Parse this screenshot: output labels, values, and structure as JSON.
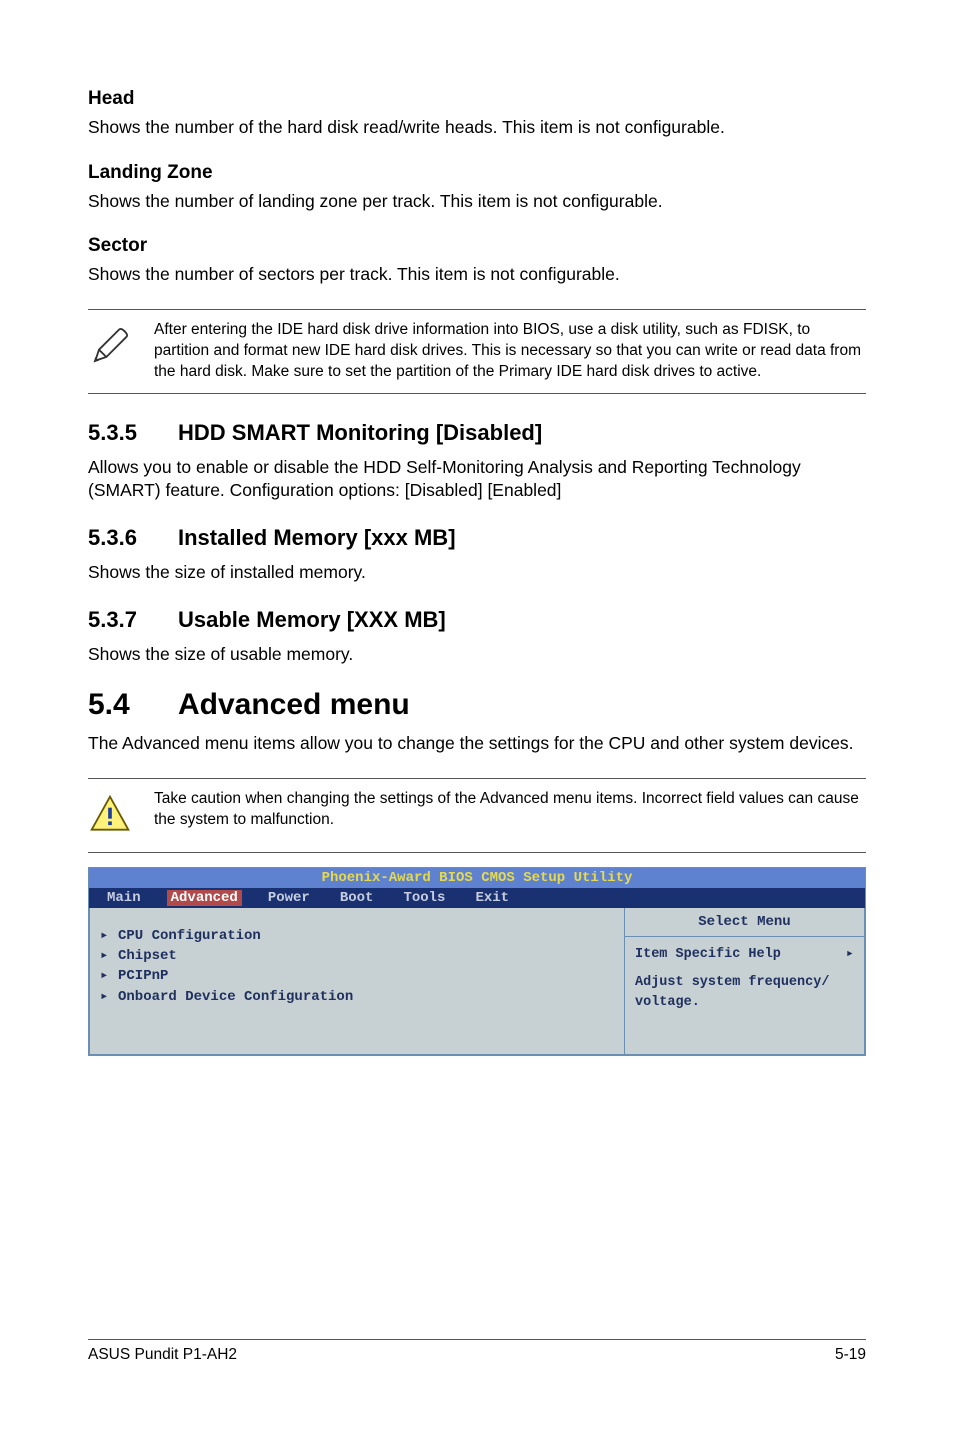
{
  "sec_head": {
    "title": "Head",
    "body": "Shows the number of the hard disk read/write heads. This item is not configurable."
  },
  "sec_lz": {
    "title": "Landing Zone",
    "body": "Shows the number of landing zone per track. This item is not configurable."
  },
  "sec_sect": {
    "title": "Sector",
    "body": "Shows the number of sectors per track. This item is not configurable."
  },
  "note1": "After entering the IDE hard disk drive information into BIOS, use a disk utility, such as FDISK, to partition and format new IDE hard disk drives. This is necessary so that you can write or read data from the hard disk. Make sure to set the partition of the Primary IDE hard disk drives to active.",
  "s535": {
    "no": "5.3.5",
    "title": "HDD SMART Monitoring [Disabled]",
    "body": "Allows you to enable or disable the HDD Self-Monitoring Analysis and Reporting Technology (SMART) feature. Configuration options: [Disabled] [Enabled]"
  },
  "s536": {
    "no": "5.3.6",
    "title": "Installed Memory [xxx MB]",
    "body": "Shows the size of installed memory."
  },
  "s537": {
    "no": "5.3.7",
    "title": "Usable Memory [XXX MB]",
    "body": "Shows the size of usable memory."
  },
  "s54": {
    "no": "5.4",
    "title": "Advanced menu",
    "body": "The Advanced menu items allow you to change the settings for the CPU and other system devices."
  },
  "note2": "Take caution when changing the settings of the Advanced menu items. Incorrect field values can cause the system to malfunction.",
  "bios": {
    "title": "Phoenix-Award BIOS CMOS Setup Utility",
    "tabs": [
      "Main",
      "Advanced",
      "Power",
      "Boot",
      "Tools",
      "Exit"
    ],
    "selected_tab": 1,
    "left": [
      "CPU Configuration",
      "Chipset",
      "PCIPnP",
      "Onboard Device Configuration"
    ],
    "right_title": "Select Menu",
    "right_line1": "Item Specific Help",
    "right_body": "Adjust system frequency/ voltage."
  },
  "footer": {
    "left": "ASUS Pundit P1-AH2",
    "right": "5-19"
  },
  "glyphs": {
    "tri": "▶",
    "tri_small": "▸"
  }
}
